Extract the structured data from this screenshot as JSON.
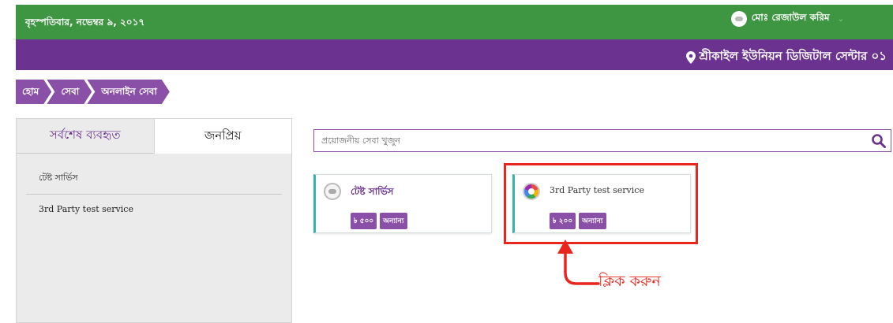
{
  "topbar": {
    "date": "বৃহস্পতিবার, নভেম্বর ৯, ২০১৭",
    "user_name": "মোঃ রেজাউল করিম",
    "caret": "⌄"
  },
  "purplebar": {
    "center_name": "শ্রীকাইল ইউনিয়ন ডিজিটাল সেন্টার ০১",
    "pin_icon": "map-pin-icon"
  },
  "breadcrumb": [
    "হোম",
    "সেবা",
    "অনলাইন সেবা"
  ],
  "sidebar": {
    "tabs": [
      {
        "label": "সর্বশেষ ব্যবহৃত",
        "active": true
      },
      {
        "label": "জনপ্রিয়",
        "active": false
      }
    ],
    "recent": [
      "টেষ্ট সার্ভিস",
      "3rd Party test service"
    ]
  },
  "search": {
    "placeholder": "প্রয়োজনীয় সেবা খুজুন",
    "icon": "search-icon"
  },
  "services": [
    {
      "name": "টেষ্ট সার্ভিস",
      "price": "৳ ৫০০",
      "category": "অন্যান্য"
    },
    {
      "name": "3rd Party test service",
      "price": "৳ ২০০",
      "category": "অন্যান্য"
    }
  ],
  "annotation": {
    "text": "ক্লিক করুন",
    "color": "#e8261e"
  },
  "colors": {
    "topbar": "#3f9642",
    "purplebar": "#6b3290",
    "accent": "#8a4fa6",
    "card_border": "#39b3a8"
  }
}
